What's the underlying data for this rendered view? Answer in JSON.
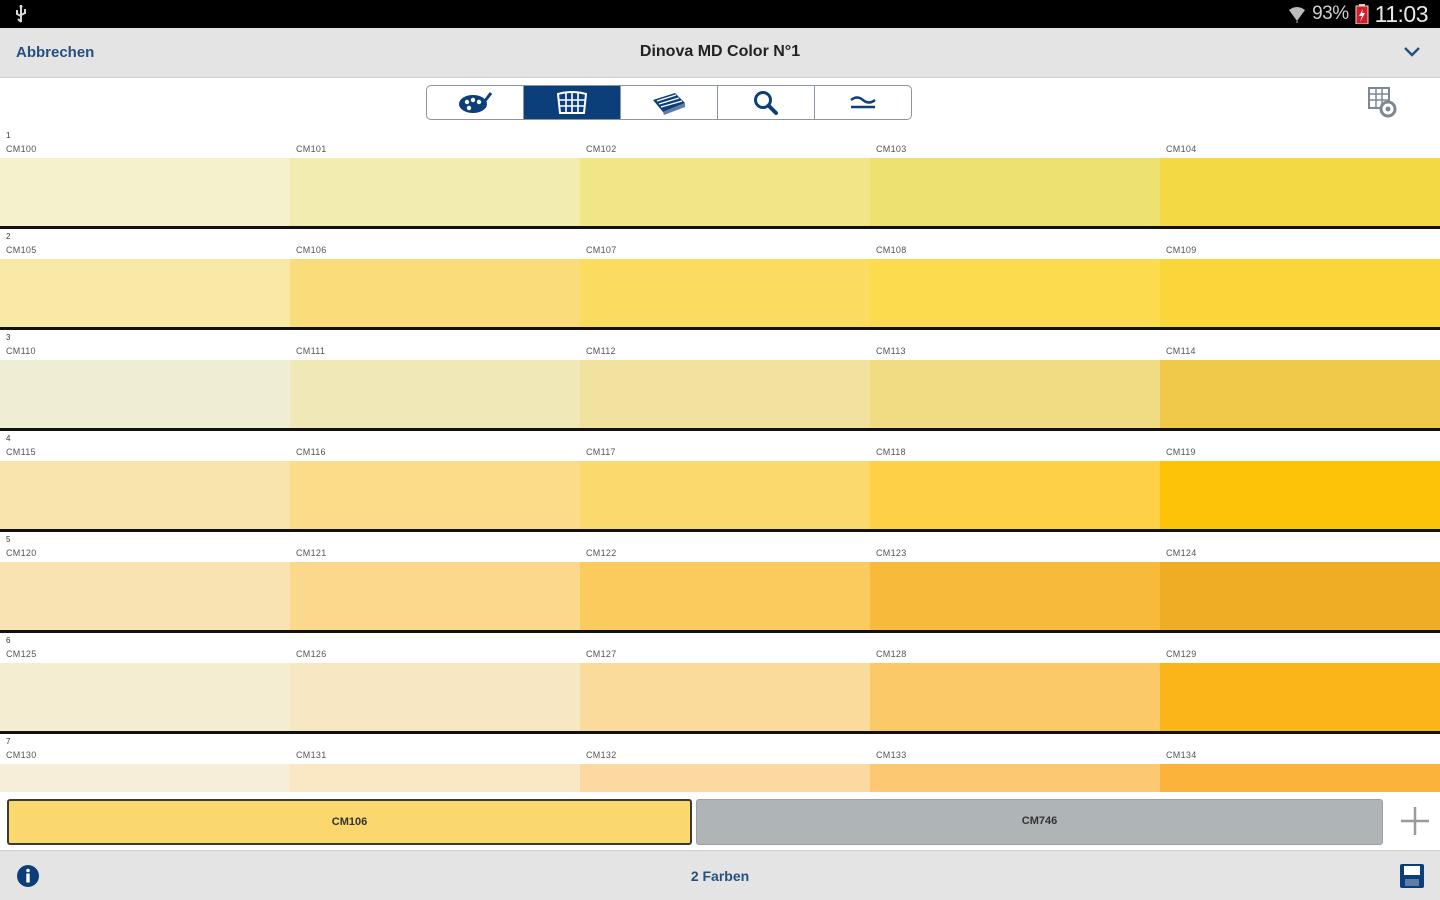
{
  "statusbar": {
    "battery": "93%",
    "time": "11:03"
  },
  "header": {
    "cancel_label": "Abbrechen",
    "title": "Dinova MD Color N°1"
  },
  "toolbar": {
    "tabs": [
      {
        "icon": "palette-brush-icon",
        "active": false
      },
      {
        "icon": "color-grid-icon",
        "active": true
      },
      {
        "icon": "color-fan-icon",
        "active": false
      },
      {
        "icon": "search-icon",
        "active": false
      },
      {
        "icon": "approximately-equal-icon",
        "active": false
      }
    ]
  },
  "grid": {
    "rows": [
      {
        "index": "1",
        "cells": [
          {
            "code": "CM100",
            "color": "#f6f1cd"
          },
          {
            "code": "CM101",
            "color": "#f3ecb0"
          },
          {
            "code": "CM102",
            "color": "#f0e686"
          },
          {
            "code": "CM103",
            "color": "#ede172"
          },
          {
            "code": "CM104",
            "color": "#f3d944"
          }
        ]
      },
      {
        "index": "2",
        "cells": [
          {
            "code": "CM105",
            "color": "#f8e9a6"
          },
          {
            "code": "CM106",
            "color": "#f9dd7b"
          },
          {
            "code": "CM107",
            "color": "#fbdc5f"
          },
          {
            "code": "CM108",
            "color": "#fcdb4e"
          },
          {
            "code": "CM109",
            "color": "#fbd63a"
          }
        ]
      },
      {
        "index": "3",
        "cells": [
          {
            "code": "CM110",
            "color": "#efeed4"
          },
          {
            "code": "CM111",
            "color": "#f1e8b8"
          },
          {
            "code": "CM112",
            "color": "#f1e39f"
          },
          {
            "code": "CM113",
            "color": "#f1dc83"
          },
          {
            "code": "CM114",
            "color": "#f0c94b"
          }
        ]
      },
      {
        "index": "4",
        "cells": [
          {
            "code": "CM115",
            "color": "#fae4ad"
          },
          {
            "code": "CM116",
            "color": "#fbdc89"
          },
          {
            "code": "CM117",
            "color": "#fcd96c"
          },
          {
            "code": "CM118",
            "color": "#fdd045"
          },
          {
            "code": "CM119",
            "color": "#fcc307"
          }
        ]
      },
      {
        "index": "5",
        "cells": [
          {
            "code": "CM120",
            "color": "#fae3b3"
          },
          {
            "code": "CM121",
            "color": "#fbd88b"
          },
          {
            "code": "CM122",
            "color": "#fccb5d"
          },
          {
            "code": "CM123",
            "color": "#f8ba3a"
          },
          {
            "code": "CM124",
            "color": "#efad25"
          }
        ]
      },
      {
        "index": "6",
        "cells": [
          {
            "code": "CM125",
            "color": "#f5edd2"
          },
          {
            "code": "CM126",
            "color": "#f7e7c2"
          },
          {
            "code": "CM127",
            "color": "#fbdb9c"
          },
          {
            "code": "CM128",
            "color": "#fcc969"
          },
          {
            "code": "CM129",
            "color": "#fcb518"
          }
        ]
      },
      {
        "index": "7",
        "cells": [
          {
            "code": "CM130",
            "color": "#f7eed9"
          },
          {
            "code": "CM131",
            "color": "#fae7c3"
          },
          {
            "code": "CM132",
            "color": "#fcd9a0"
          },
          {
            "code": "CM133",
            "color": "#fcc872"
          },
          {
            "code": "CM134",
            "color": "#fbb33c"
          }
        ]
      }
    ]
  },
  "selection": {
    "chips": [
      {
        "code": "CM106",
        "color": "#fad86e"
      },
      {
        "code": "CM746",
        "color": "#afb4b7"
      }
    ]
  },
  "footer": {
    "count_label": "2 Farben"
  }
}
